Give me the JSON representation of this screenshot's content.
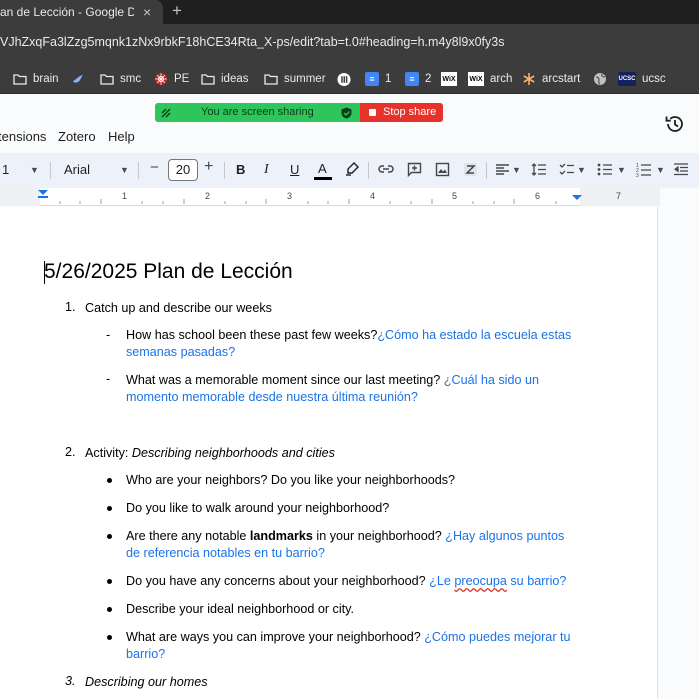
{
  "browser": {
    "tab_title": "an de Lección - Google Doc",
    "tab_close": "×",
    "new_tab": "+",
    "url": "VJhZxqFa3lZzg5mqnk1zNx9rbkF18hCE34Rta_X-ps/edit?tab=t.0#heading=h.m4y8l9x0fy3s"
  },
  "bookmarks": [
    {
      "label": "brain",
      "icon": "folder-icon"
    },
    {
      "label": "",
      "icon": "bird-icon"
    },
    {
      "label": "smc",
      "icon": "folder-icon"
    },
    {
      "label": "PE",
      "icon": "wheel-icon"
    },
    {
      "label": "ideas",
      "icon": "folder-icon"
    },
    {
      "label": "summer",
      "icon": "folder-icon"
    },
    {
      "label": "",
      "icon": "record-icon"
    },
    {
      "label": "1",
      "icon": "docs-icon"
    },
    {
      "label": "2",
      "icon": "docs-icon"
    },
    {
      "label": "",
      "icon": "wix-icon"
    },
    {
      "label": "arch",
      "icon": "wix-icon"
    },
    {
      "label": "arcstart",
      "icon": "snowflake-icon"
    },
    {
      "label": "",
      "icon": "globe-icon"
    },
    {
      "label": "ucsc",
      "icon": "ucsc-icon"
    }
  ],
  "icon_text": {
    "docs": "≡",
    "wix": "WiX",
    "ucsc": "UCSC"
  },
  "menus": [
    "tensions",
    "Zotero",
    "Help"
  ],
  "screen_share": {
    "status": "You are screen sharing",
    "stop": "Stop share"
  },
  "toolbar": {
    "zoom_partial": "1",
    "font": "Arial",
    "font_size": "20",
    "minus": "−",
    "plus": "+",
    "bold": "B",
    "italic": "I",
    "underline": "U",
    "text_color": "A"
  },
  "ruler_numbers": [
    "1",
    "2",
    "3",
    "4",
    "5",
    "6",
    "7"
  ],
  "document": {
    "title": "5/26/2025 Plan de Lección",
    "section1": {
      "number": "1.",
      "text": "Catch up and describe our weeks",
      "items": [
        {
          "marker": "-",
          "en": "How has school been these past few weeks?",
          "es_1": "¿Cómo ha estado la escuela estas",
          "es_2": "semanas pasadas?"
        },
        {
          "marker": "-",
          "en": "What was a memorable moment since our last meeting? ",
          "es_1": "¿Cuál ha sido un",
          "es_2": "momento memorable desde nuestra última reunión?"
        }
      ]
    },
    "section2": {
      "number": "2.",
      "prefix": "Activity: ",
      "text": "Describing neighborhoods and cities",
      "items": [
        {
          "en": "Who are your neighbors? Do you like your neighborhoods?"
        },
        {
          "en": "Do you like to walk around your neighborhood?"
        },
        {
          "en_a": "Are there any notable ",
          "en_bold": "landmarks",
          "en_b": " in your neighborhood? ",
          "es_1": "¿Hay algunos puntos",
          "es_2": "de referencia notables en tu barrio?"
        },
        {
          "en": "Do you have any concerns about your neighborhood? ",
          "es_a": "¿Le ",
          "es_squiggle": "preocupa",
          "es_b": " su barrio?"
        },
        {
          "en": "Describe your ideal neighborhood or city."
        },
        {
          "en": "What are ways you can improve your neighborhood? ",
          "es_1": "¿Cómo puedes mejorar tu",
          "es_2": "barrio?"
        }
      ]
    },
    "section3": {
      "number": "3.",
      "text": "Describing our homes"
    }
  }
}
